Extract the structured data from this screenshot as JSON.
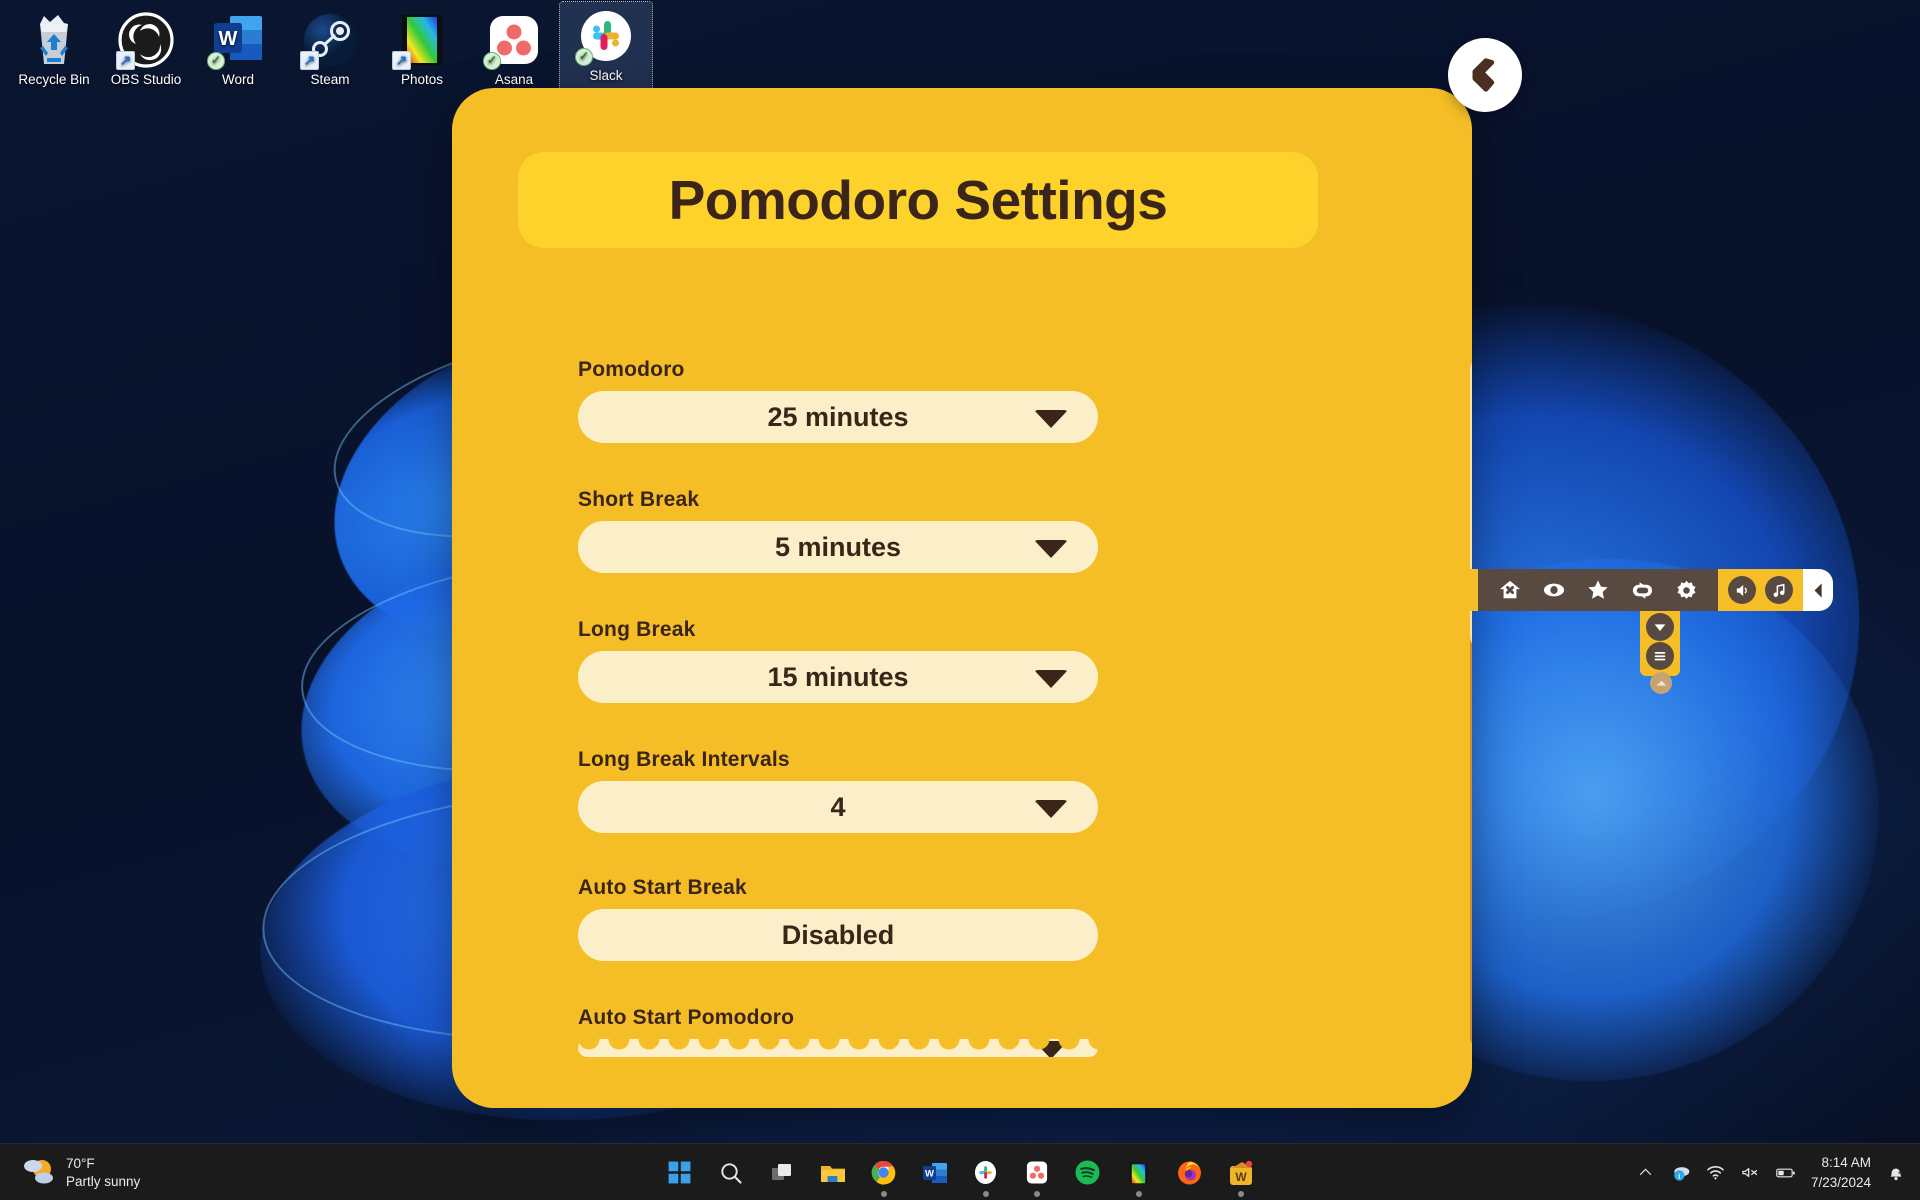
{
  "desktop": {
    "icons": [
      {
        "label": "Recycle Bin",
        "icon": "recycle-bin-icon",
        "badge": "none",
        "selected": false
      },
      {
        "label": "OBS Studio",
        "icon": "obs-studio-icon",
        "badge": "shortcut",
        "selected": false
      },
      {
        "label": "Word",
        "icon": "word-icon",
        "badge": "check",
        "selected": false
      },
      {
        "label": "Steam",
        "icon": "steam-icon",
        "badge": "shortcut",
        "selected": false
      },
      {
        "label": "Photos",
        "icon": "photos-icon",
        "badge": "shortcut",
        "selected": false
      },
      {
        "label": "Asana",
        "icon": "asana-icon",
        "badge": "check",
        "selected": false
      },
      {
        "label": "Slack",
        "icon": "slack-icon",
        "badge": "check",
        "selected": true
      }
    ]
  },
  "modal": {
    "title": "Pomodoro Settings",
    "close_icon": "back-chevron-icon",
    "fields": [
      {
        "label": "Pomodoro",
        "value": "25 minutes",
        "has_caret": true,
        "clipped": false
      },
      {
        "label": "Short Break",
        "value": "5 minutes",
        "has_caret": true,
        "clipped": false
      },
      {
        "label": "Long Break",
        "value": "15 minutes",
        "has_caret": true,
        "clipped": false
      },
      {
        "label": "Long Break Intervals",
        "value": "4",
        "has_caret": true,
        "clipped": false
      },
      {
        "label": "Auto Start Break",
        "value": "Disabled",
        "has_caret": false,
        "clipped": false
      },
      {
        "label": "Auto Start Pomodoro",
        "value": "",
        "has_caret": true,
        "clipped": true
      }
    ],
    "colors": {
      "panel": "#F5BE26",
      "title_bar": "#FDD32B",
      "control": "#FAEFC8",
      "text": "#3B2418",
      "scroll_track": "#C98F2F",
      "scroll_thumb": "#FAE2AE"
    },
    "scrollbar": {
      "thumb_top_pct": 0,
      "thumb_height_pct": 42
    }
  },
  "floating_toolbar": {
    "dark_icons": [
      "home-icon",
      "eye-icon",
      "star-icon",
      "loop-icon",
      "gear-icon"
    ],
    "yellow_icons": [
      "speaker-icon",
      "music-note-icon"
    ],
    "end_icon": "collapse-left-icon",
    "vertical_icons": [
      "chevron-down-icon",
      "menu-icon"
    ],
    "handle_icon": "drag-handle-icon"
  },
  "taskbar": {
    "weather": {
      "temperature": "70°F",
      "condition": "Partly sunny",
      "icon": "partly-sunny-icon"
    },
    "apps": [
      {
        "name": "start-button",
        "icon": "windows-logo-icon",
        "running": false
      },
      {
        "name": "search-button",
        "icon": "search-icon",
        "running": false
      },
      {
        "name": "task-view",
        "icon": "task-view-icon",
        "running": false
      },
      {
        "name": "file-explorer",
        "icon": "folder-icon",
        "running": false
      },
      {
        "name": "chrome",
        "icon": "chrome-icon",
        "running": true
      },
      {
        "name": "word",
        "icon": "word-icon",
        "running": false
      },
      {
        "name": "slack",
        "icon": "slack-icon",
        "running": true
      },
      {
        "name": "asana",
        "icon": "asana-icon",
        "running": true
      },
      {
        "name": "spotify",
        "icon": "spotify-icon",
        "running": false
      },
      {
        "name": "photos",
        "icon": "photos-icon",
        "running": true
      },
      {
        "name": "firefox",
        "icon": "firefox-icon",
        "running": false
      },
      {
        "name": "pomodoro-app",
        "icon": "pomodoro-app-icon",
        "running": true
      }
    ],
    "tray": {
      "chevron_icon": "show-hidden-icons-icon",
      "cloud_icon": "onedrive-icon",
      "wifi_icon": "wifi-icon",
      "volume_icon": "volume-muted-icon",
      "battery_icon": "battery-icon",
      "time": "8:14 AM",
      "date": "7/23/2024",
      "notification_icon": "do-not-disturb-bell-icon"
    }
  }
}
